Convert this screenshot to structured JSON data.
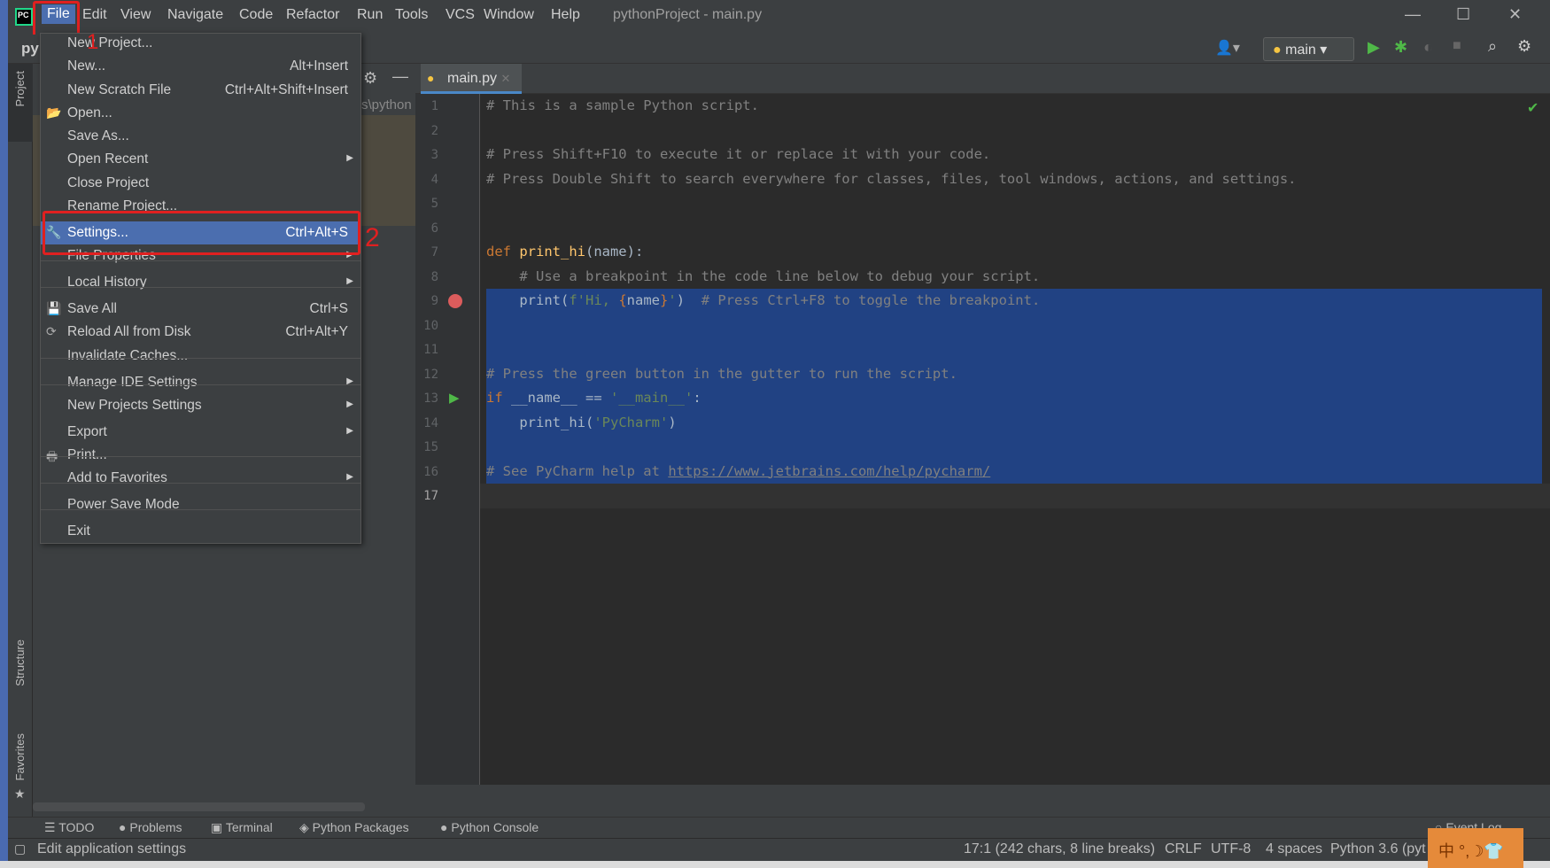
{
  "window": {
    "title": "pythonProject - main.py",
    "minimize": "—",
    "maximize": "☐",
    "close": "✕"
  },
  "menubar": [
    "File",
    "Edit",
    "View",
    "Navigate",
    "Code",
    "Refactor",
    "Run",
    "Tools",
    "VCS",
    "Window",
    "Help"
  ],
  "toolbar": {
    "project_short": "py",
    "run_config": "main"
  },
  "left_strip": {
    "project": "Project",
    "structure": "Structure",
    "favorites": "Favorites"
  },
  "project_panel": {
    "path_fragment": "s\\python"
  },
  "tab": {
    "label": "main.py"
  },
  "file_menu": [
    {
      "label": "New Project...",
      "shortcut": ""
    },
    {
      "label": "New...",
      "shortcut": "Alt+Insert"
    },
    {
      "label": "New Scratch File",
      "shortcut": "Ctrl+Alt+Shift+Insert"
    },
    {
      "label": "Open...",
      "shortcut": "",
      "icon": "folder-icon"
    },
    {
      "label": "Save As...",
      "shortcut": ""
    },
    {
      "label": "Open Recent",
      "shortcut": "",
      "submenu": true
    },
    {
      "label": "Close Project",
      "shortcut": ""
    },
    {
      "label": "Rename Project...",
      "shortcut": ""
    },
    {
      "label": "Settings...",
      "shortcut": "Ctrl+Alt+S",
      "icon": "wrench-icon",
      "highlighted": true
    },
    {
      "label": "File Properties",
      "shortcut": "",
      "submenu": true
    },
    {
      "label": "Local History",
      "shortcut": "",
      "submenu": true
    },
    {
      "label": "Save All",
      "shortcut": "Ctrl+S",
      "icon": "save-icon"
    },
    {
      "label": "Reload All from Disk",
      "shortcut": "Ctrl+Alt+Y",
      "icon": "reload-icon"
    },
    {
      "label": "Invalidate Caches...",
      "shortcut": ""
    },
    {
      "label": "Manage IDE Settings",
      "shortcut": "",
      "submenu": true
    },
    {
      "label": "New Projects Settings",
      "shortcut": "",
      "submenu": true
    },
    {
      "label": "Export",
      "shortcut": "",
      "submenu": true
    },
    {
      "label": "Print...",
      "shortcut": "",
      "icon": "print-icon"
    },
    {
      "label": "Add to Favorites",
      "shortcut": "",
      "submenu": true
    },
    {
      "label": "Power Save Mode",
      "shortcut": ""
    },
    {
      "label": "Exit",
      "shortcut": ""
    }
  ],
  "annotations": [
    "1",
    "2"
  ],
  "code": [
    [
      [
        "# This is a sample Python script.",
        "comment"
      ]
    ],
    [],
    [
      [
        "# Press Shift+F10 to execute it or replace it with your code.",
        "comment"
      ]
    ],
    [
      [
        "# Press Double Shift to search everywhere for classes, files, tool windows, actions, and settings.",
        "comment"
      ]
    ],
    [],
    [],
    [
      [
        "def ",
        "kw"
      ],
      [
        "print_hi",
        "fn"
      ],
      [
        "(name):",
        "text"
      ]
    ],
    [
      [
        "    # Use a breakpoint in the code line below to debug your script.",
        "comment"
      ]
    ],
    [
      [
        "    print(",
        "text"
      ],
      [
        "f'Hi, ",
        "str"
      ],
      [
        "{",
        "brace"
      ],
      [
        "name",
        "text"
      ],
      [
        "}",
        "brace"
      ],
      [
        "'",
        "str"
      ],
      [
        ")  ",
        "text"
      ],
      [
        "# Press Ctrl+F8 to toggle the breakpoint.",
        "comment"
      ]
    ],
    [],
    [],
    [
      [
        "# Press the green button in the gutter to run the script.",
        "comment"
      ]
    ],
    [
      [
        "if ",
        "kw"
      ],
      [
        "__name__ == ",
        "text"
      ],
      [
        "'__main__'",
        "str"
      ],
      [
        ":",
        "text"
      ]
    ],
    [
      [
        "    print_hi(",
        "text"
      ],
      [
        "'PyCharm'",
        "str"
      ],
      [
        ")",
        "text"
      ]
    ],
    [],
    [
      [
        "# See PyCharm help at ",
        "comment"
      ],
      [
        "https://www.jetbrains.com/help/pycharm/",
        "link"
      ]
    ],
    []
  ],
  "tool_windows": [
    "TODO",
    "Problems",
    "Terminal",
    "Python Packages",
    "Python Console",
    "Event Log"
  ],
  "status": {
    "hint": "Edit application settings",
    "position": "17:1 (242 chars, 8 line breaks)",
    "line_sep": "CRLF",
    "encoding": "UTF-8",
    "indent": "4 spaces",
    "interpreter": "Python 3.6 (pyt"
  },
  "ime": "中 °,☽👕",
  "colors": {
    "accent": "#4b6eaf",
    "selection": "#214283",
    "annotation": "#e02020",
    "editor_bg": "#2b2b2b"
  }
}
